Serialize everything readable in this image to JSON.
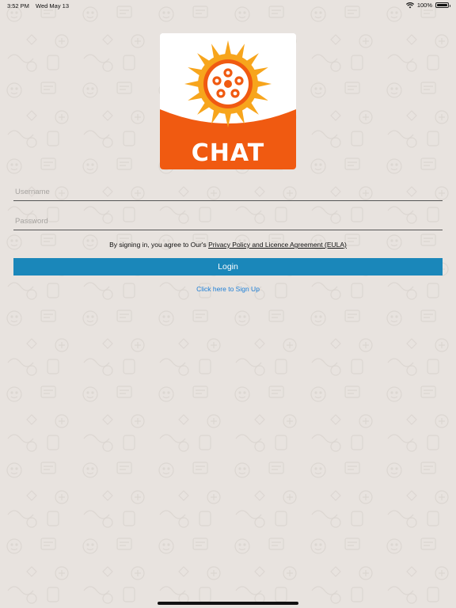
{
  "status_bar": {
    "time": "3:52 PM",
    "date": "Wed May 13",
    "battery_text": "100%",
    "battery_level": 1.0,
    "wifi_icon": "wifi-icon"
  },
  "logo": {
    "text": "CHAT",
    "colors": {
      "orange": "#f05a11",
      "sun": "#f7a51c",
      "white": "#ffffff"
    }
  },
  "form": {
    "username_placeholder": "Username",
    "password_placeholder": "Password"
  },
  "terms": {
    "prefix": "By signing in, you agree to Our's ",
    "link": "Privacy Policy and Licence Agreement (EULA)"
  },
  "login_label": "Login",
  "signup_label": "Click here to Sign Up",
  "colors": {
    "background": "#e8e3df",
    "login_button": "#1a87ba",
    "signup_link": "#1c7ed6"
  }
}
